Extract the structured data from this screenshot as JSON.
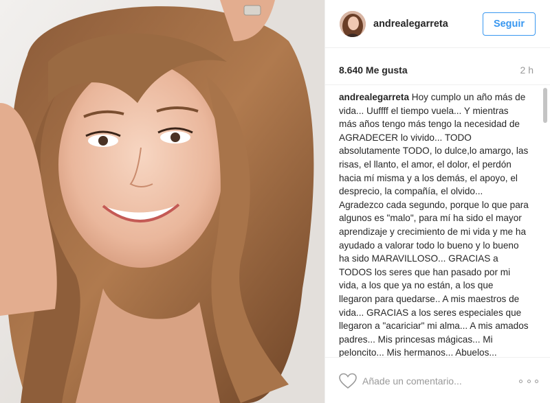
{
  "post": {
    "image_alt": "Selfie of a smiling woman with long wavy light-brown hair"
  },
  "header": {
    "username": "andrealegarreta",
    "follow_label": "Seguir"
  },
  "meta": {
    "likes": "8.640 Me gusta",
    "time": "2 h"
  },
  "caption": {
    "author": "andrealegarreta",
    "text": "Hoy cumplo un año más de vida... Uuffff el tiempo vuela... Y mientras más años tengo más tengo la necesidad de AGRADECER lo vivido... TODO absolutamente TODO, lo dulce,lo amargo, las risas, el llanto, el amor, el dolor, el perdón hacia mí misma y a los demás, el apoyo, el desprecio, la compañía, el olvido... Agradezco cada segundo, porque lo que para algunos es \"malo\", para mí ha sido el mayor aprendizaje y crecimiento de mi vida y me ha ayudado a valorar todo lo bueno y lo bueno ha sido MARAVILLOSO... GRACIAS a TODOS los seres que han pasado por mi vida, a los que ya no están, a los que llegaron para quedarse.. A mis maestros de vida... GRACIAS a los seres especiales que llegaron a \"acariciar\" mi alma... A mis amados padres... Mis princesas mágicas... Mi peloncito... Mis hermanos... Abuelos..."
  },
  "footer": {
    "comment_placeholder": "Añade un comentario...",
    "icons": [
      "heart-icon",
      "more-options-icon"
    ]
  },
  "colors": {
    "accent": "#3897f0",
    "text": "#262626",
    "muted": "#999999",
    "divider": "#efefef"
  }
}
